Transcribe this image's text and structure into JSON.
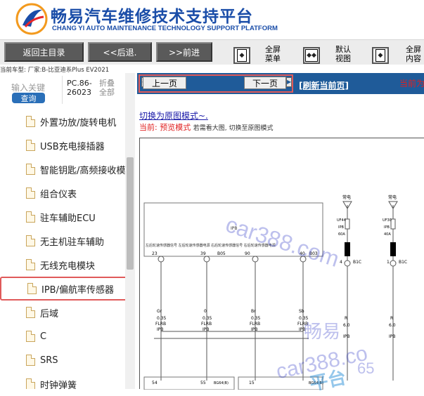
{
  "header": {
    "title": "畅易汽车维修技术支持平台",
    "subtitle": "CHANG YI AUTO MAINTENANCE TECHNOLOGY SUPPORT PLATFORM"
  },
  "toolbar": {
    "back_main": "返回主目录",
    "back": "<<后退.",
    "forward": ">>前进",
    "full_menu": "全屏\n菜单",
    "default_view": "默认\n视图",
    "full_content": "全屏\n内容"
  },
  "vehicle_line": "当前车型: 厂家:B-比亚迪系Plus EV2021",
  "sidebar": {
    "search_placeholder": "输入关键",
    "search_button": "查询",
    "pc_code": "PC.86-\n26023",
    "collapse": "折叠\n全部",
    "items": [
      {
        "label": "外置功放/旋转电机",
        "highlight": false
      },
      {
        "label": "USB充电接插器",
        "highlight": false
      },
      {
        "label": "智能钥匙/高频接收模",
        "highlight": false
      },
      {
        "label": "组合仪表",
        "highlight": false
      },
      {
        "label": "驻车辅助ECU",
        "highlight": false
      },
      {
        "label": "无主机驻车辅助",
        "highlight": false
      },
      {
        "label": "无线充电模块",
        "highlight": false
      },
      {
        "label": "IPB/偏航率传感器",
        "highlight": true
      },
      {
        "label": "后域",
        "highlight": false
      },
      {
        "label": "C",
        "highlight": false
      },
      {
        "label": "SRS",
        "highlight": false
      },
      {
        "label": "时钟弹簧",
        "highlight": false
      }
    ]
  },
  "main": {
    "prev_page": "上一页",
    "next_page": "下一页",
    "refresh": "[刷新当前页]",
    "current_prefix": "当前为",
    "switch_link": "切换为原图模式~.",
    "status_prefix": "当前:",
    "status_mode": "预览模式",
    "status_hint": "若需看大图, 切换至原图模式"
  },
  "diagram": {
    "module_label": "IPB",
    "header_text": "左后轮速传感器信号 左后轮速传感器电源 右后轮速传感器信号 右后轮速传感器电源",
    "pins_top": [
      "23",
      "39",
      "B05",
      "90",
      "40",
      "B03"
    ],
    "wires": [
      {
        "color": "Gr",
        "size": "0.35",
        "type": "FLRB",
        "sys": "IPB"
      },
      {
        "color": "0",
        "size": "0.35",
        "type": "FLRB",
        "sys": "IPB"
      },
      {
        "color": "Br",
        "size": "0.35",
        "type": "FLRB",
        "sys": "IPB"
      },
      {
        "color": "Sb",
        "size": "0.35",
        "type": "FLRB",
        "sys": "IPB"
      }
    ],
    "fuses": [
      {
        "top": "常电",
        "code": "UF44",
        "sys": "IPB",
        "amp": "60A",
        "pin": "B1C",
        "num": "4"
      },
      {
        "top": "常电",
        "code": "UF30",
        "sys": "IPB",
        "amp": "40A",
        "pin": "B1C",
        "num": "1"
      }
    ],
    "right_wires": [
      {
        "color": "R",
        "size": "6.0",
        "sys": "IPB"
      },
      {
        "color": "R",
        "size": "6.0",
        "sys": "IPB"
      }
    ],
    "pins_bottom": [
      "54",
      "55",
      "BG64(B)",
      "15",
      "BG64(B)"
    ]
  },
  "watermarks": [
    "car388.com",
    "畅易",
    "car388.co",
    "平台",
    "65"
  ],
  "colors": {
    "brand": "#1a4da8",
    "toolbar_button": "#5a5a5a",
    "navbar": "#1f5b99",
    "highlight": "#e05a5a",
    "search_button": "#2a6fb8"
  }
}
